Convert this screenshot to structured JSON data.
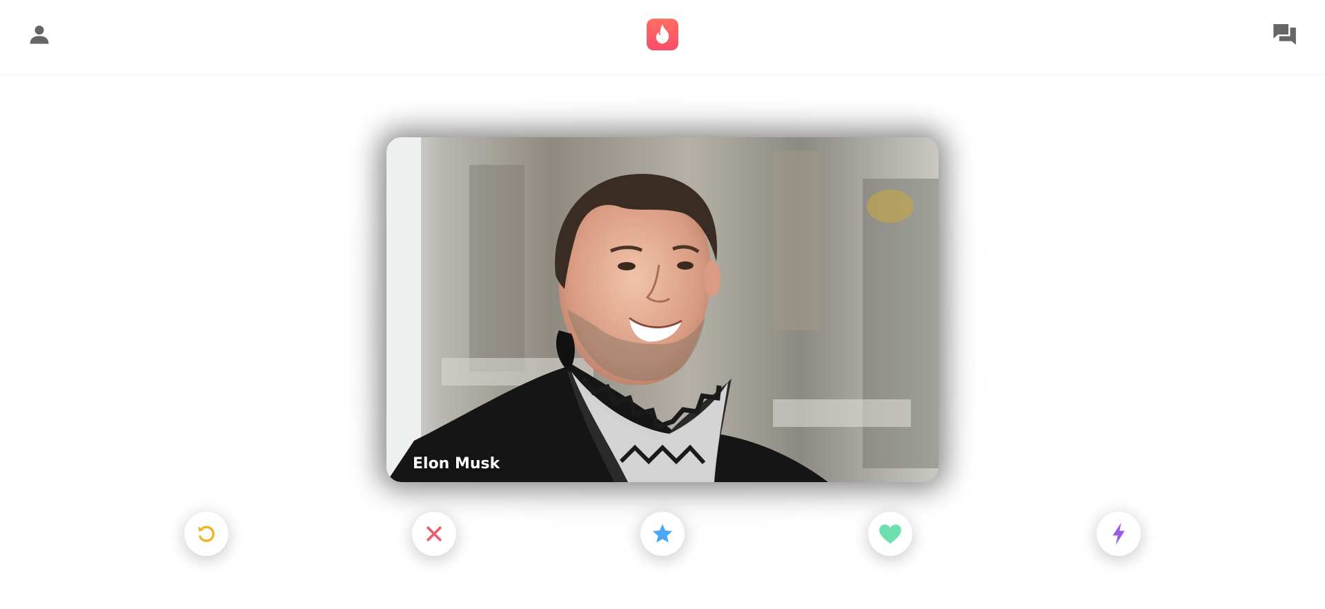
{
  "header": {
    "profile_icon": "person-icon",
    "logo_icon": "flame-icon",
    "messages_icon": "chat-bubbles-icon"
  },
  "card": {
    "name": "Elon Musk"
  },
  "actions": [
    {
      "name": "rewind",
      "icon": "rewind-icon",
      "color": "#f0b429"
    },
    {
      "name": "nope",
      "icon": "close-icon",
      "color": "#ec5e6f"
    },
    {
      "name": "super-like",
      "icon": "star-icon",
      "color": "#4ba8f5"
    },
    {
      "name": "like",
      "icon": "heart-icon",
      "color": "#6ee0b0"
    },
    {
      "name": "boost",
      "icon": "lightning-icon",
      "color": "#9b5de5"
    }
  ],
  "colors": {
    "brand": "#fd5068",
    "icon_gray": "#666666"
  }
}
